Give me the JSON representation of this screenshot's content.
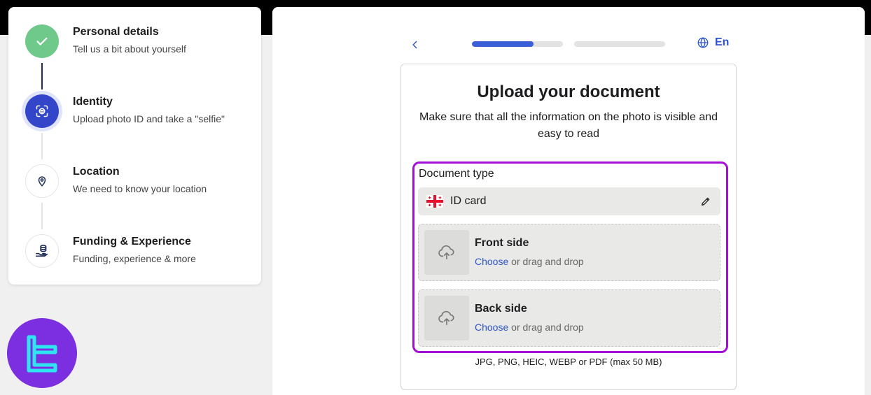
{
  "steps": [
    {
      "title": "Personal details",
      "subtitle": "Tell us a bit about yourself",
      "status": "done",
      "icon": "check-icon"
    },
    {
      "title": "Identity",
      "subtitle": "Upload photo ID and take a \"selfie\"",
      "status": "active",
      "icon": "face-scan-icon"
    },
    {
      "title": "Location",
      "subtitle": "We need to know your location",
      "status": "pending",
      "icon": "location-pin-icon"
    },
    {
      "title": "Funding & Experience",
      "subtitle": "Funding, experience & more",
      "status": "pending",
      "icon": "coins-hand-icon"
    }
  ],
  "header": {
    "language": "En",
    "progress": [
      0.68,
      0
    ]
  },
  "card": {
    "title": "Upload your document",
    "subtitle": "Make sure that all the information on the photo is visible and easy to read",
    "document_type_label": "Document type",
    "document_type_value": "ID card",
    "front": {
      "title": "Front side",
      "choose": "Choose",
      "hint": " or drag and drop"
    },
    "back": {
      "title": "Back side",
      "choose": "Choose",
      "hint": " or drag and drop"
    },
    "formats": "JPG, PNG, HEIC, WEBP or PDF (max 50 MB)"
  },
  "colors": {
    "accent": "#3a5fd6",
    "done": "#6ec98a",
    "highlight": "#a30fd6",
    "logo": "#7b2fe0"
  }
}
